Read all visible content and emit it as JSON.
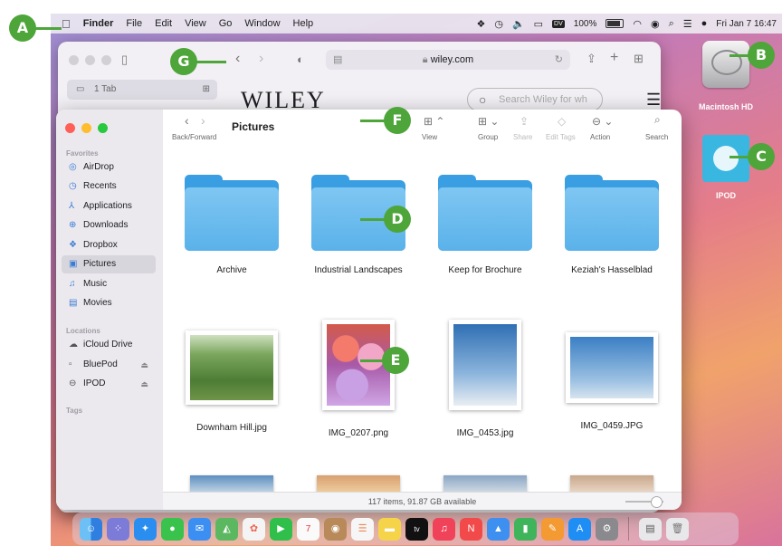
{
  "menubar": {
    "apple_icon": "apple-logo",
    "items": [
      "Finder",
      "File",
      "Edit",
      "View",
      "Go",
      "Window",
      "Help"
    ],
    "battery": "100%",
    "datetime": "Fri Jan 7  16:47",
    "dv_badge": "DV"
  },
  "desktop": {
    "macintosh_hd": "Macintosh HD",
    "ipod": "IPOD"
  },
  "safari": {
    "tab_label": "1 Tab",
    "url": "wiley.com",
    "site_logo": "WILEY",
    "search_placeholder": "Search Wiley for wh"
  },
  "finder": {
    "title": "Pictures",
    "toolbar": {
      "back_forward": "Back/Forward",
      "view": "View",
      "group": "Group",
      "share": "Share",
      "edit_tags": "Edit Tags",
      "action": "Action",
      "search": "Search"
    },
    "sidebar": {
      "favorites_header": "Favorites",
      "favorites": [
        "AirDrop",
        "Recents",
        "Applications",
        "Downloads",
        "Dropbox",
        "Pictures",
        "Music",
        "Movies"
      ],
      "locations_header": "Locations",
      "locations": [
        "iCloud Drive",
        "BluePod",
        "IPOD"
      ],
      "tags_header": "Tags"
    },
    "items": [
      "Archive",
      "Industrial Landscapes",
      "Keep for Brochure",
      "Keziah's Hasselblad",
      "Downham Hill.jpg",
      "IMG_0207.png",
      "IMG_0453.jpg",
      "IMG_0459.JPG"
    ],
    "status": "117 items, 91.87 GB available"
  },
  "callouts": [
    "A",
    "B",
    "C",
    "D",
    "E",
    "F",
    "G"
  ],
  "colors": {
    "callout_green": "#4ea53a",
    "folder_blue": "#5ab2ea",
    "accent_blue": "#3a7bd5"
  }
}
